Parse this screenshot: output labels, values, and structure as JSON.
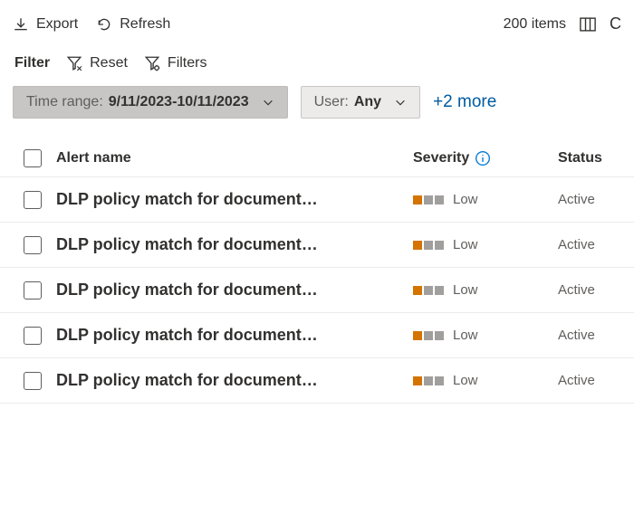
{
  "toolbar": {
    "export_label": "Export",
    "refresh_label": "Refresh",
    "items_text": "200 items"
  },
  "filters": {
    "label": "Filter",
    "reset_label": "Reset",
    "filters_label": "Filters",
    "time_range_label": "Time range:",
    "time_range_value": "9/11/2023-10/11/2023",
    "user_label": "User:",
    "user_value": "Any",
    "more_label": "+2 more"
  },
  "columns": {
    "name": "Alert name",
    "severity": "Severity",
    "status": "Status"
  },
  "rows": [
    {
      "name": "DLP policy match for document…",
      "severity_text": "Low",
      "severity_level": 1,
      "status": "Active"
    },
    {
      "name": "DLP policy match for document…",
      "severity_text": "Low",
      "severity_level": 1,
      "status": "Active"
    },
    {
      "name": "DLP policy match for document…",
      "severity_text": "Low",
      "severity_level": 1,
      "status": "Active"
    },
    {
      "name": "DLP policy match for document…",
      "severity_text": "Low",
      "severity_level": 1,
      "status": "Active"
    },
    {
      "name": "DLP policy match for document…",
      "severity_text": "Low",
      "severity_level": 1,
      "status": "Active"
    }
  ]
}
